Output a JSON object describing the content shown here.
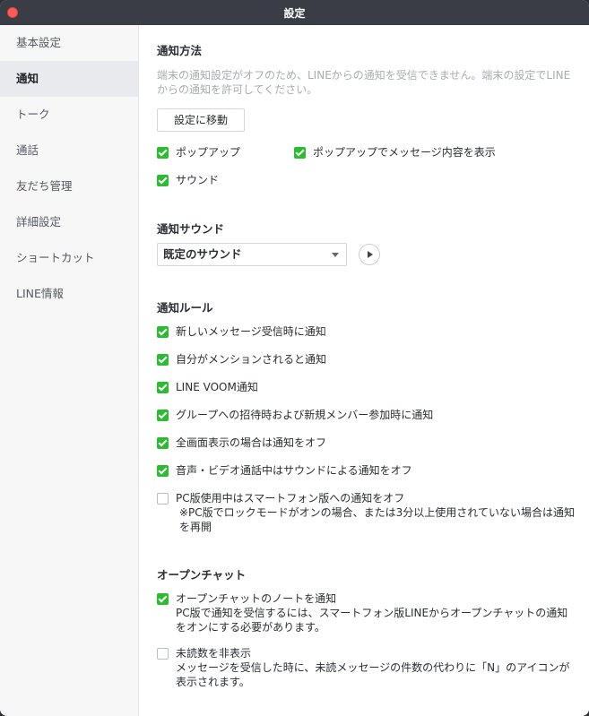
{
  "window": {
    "title": "設定"
  },
  "sidebar": {
    "items": [
      {
        "label": "基本設定"
      },
      {
        "label": "通知"
      },
      {
        "label": "トーク"
      },
      {
        "label": "通話"
      },
      {
        "label": "友だち管理"
      },
      {
        "label": "詳細設定"
      },
      {
        "label": "ショートカット"
      },
      {
        "label": "LINE情報"
      }
    ]
  },
  "method": {
    "title": "通知方法",
    "note": "端末の通知設定がオフのため、LINEからの通知を受信できません。端末の設定でLINEからの通知を許可してください。",
    "button": "設定に移動",
    "popup": {
      "label": "ポップアップ",
      "checked": true
    },
    "popup_content": {
      "label": "ポップアップでメッセージ内容を表示",
      "checked": true
    },
    "sound": {
      "label": "サウンド",
      "checked": true
    }
  },
  "sound_section": {
    "title": "通知サウンド",
    "selected": "既定のサウンド"
  },
  "rules": {
    "title": "通知ルール",
    "items": [
      {
        "label": "新しいメッセージ受信時に通知",
        "checked": true
      },
      {
        "label": "自分がメンションされると通知",
        "checked": true
      },
      {
        "label": "LINE VOOM通知",
        "checked": true
      },
      {
        "label": "グループへの招待時および新規メンバー参加時に通知",
        "checked": true
      },
      {
        "label": "全画面表示の場合は通知をオフ",
        "checked": true
      },
      {
        "label": "音声・ビデオ通話中はサウンドによる通知をオフ",
        "checked": true
      },
      {
        "label": "PC版使用中はスマートフォン版への通知をオフ",
        "checked": false,
        "sub": "※PC版でロックモードがオンの場合、または3分以上使用されていない場合は通知を再開"
      }
    ]
  },
  "openchat": {
    "title": "オープンチャット",
    "items": [
      {
        "label": "オープンチャットのノートを通知",
        "checked": true,
        "sub": "PC版で通知を受信するには、スマートフォン版LINEからオープンチャットの通知をオンにする必要があります。"
      },
      {
        "label": "未読数を非表示",
        "checked": false,
        "sub": "メッセージを受信した時に、未読メッセージの件数の代わりに「N」のアイコンが表示されます。"
      }
    ]
  }
}
